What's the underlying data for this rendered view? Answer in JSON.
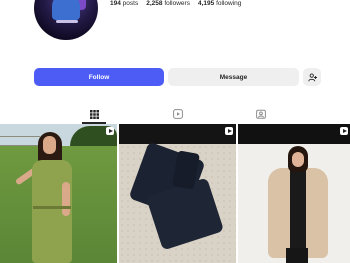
{
  "profile": {
    "posts_count": "194",
    "posts_label": "posts",
    "followers_count": "2,258",
    "followers_label": "followers",
    "following_count": "4,195",
    "following_label": "following"
  },
  "actions": {
    "follow_label": "Follow",
    "message_label": "Message",
    "suggest_icon": "add-person-icon"
  },
  "tabs": [
    {
      "name": "posts",
      "icon": "grid-icon",
      "active": true
    },
    {
      "name": "reels",
      "icon": "reels-icon",
      "active": false
    },
    {
      "name": "tagged",
      "icon": "tagged-icon",
      "active": false
    }
  ],
  "grid": [
    {
      "type": "reel"
    },
    {
      "type": "reel"
    },
    {
      "type": "reel"
    }
  ],
  "colors": {
    "follow_button": "#4c5cf5",
    "secondary_button": "#efefef",
    "text": "#262626"
  }
}
